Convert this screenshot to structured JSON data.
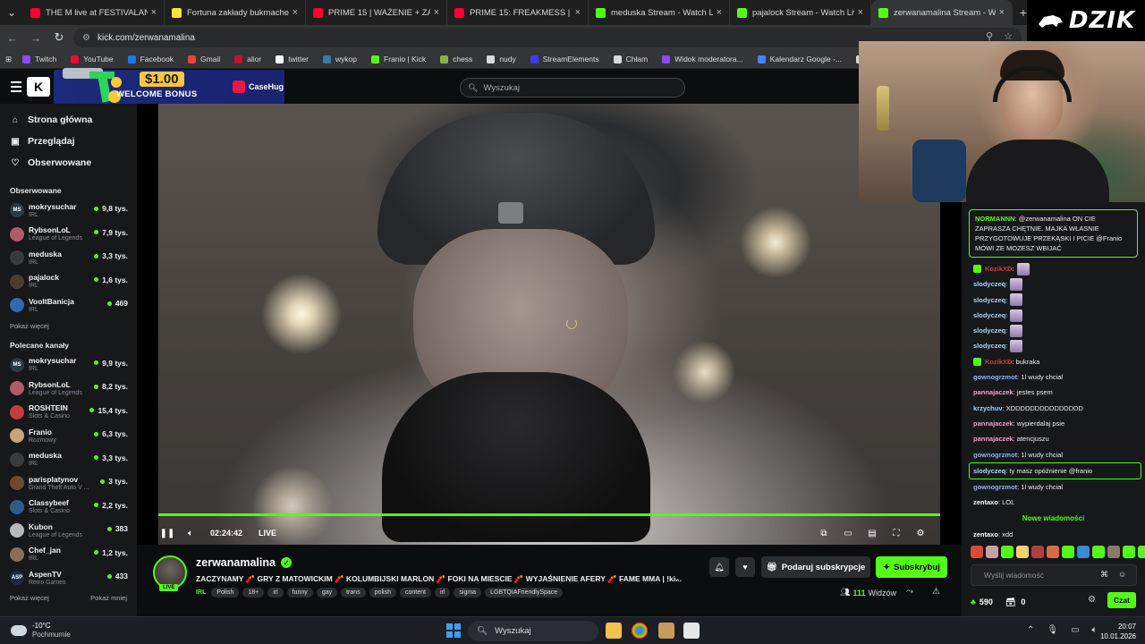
{
  "browser": {
    "tabs": [
      {
        "title": "THE M live at FESTIVALAND 20",
        "favicon_color": "#ff0033"
      },
      {
        "title": "Fortuna zakłady bukmacherskie",
        "favicon_color": "#f6e23b"
      },
      {
        "title": "PRIME 15 | WAŻENIE + ZADYM",
        "favicon_color": "#ff0033"
      },
      {
        "title": "PRIME 15: FREAKMESS | 24H PI",
        "favicon_color": "#ff0033"
      },
      {
        "title": "meduska Stream - Watch Li",
        "favicon_color": "#53fc18"
      },
      {
        "title": "pajalock Stream - Watch Live o",
        "favicon_color": "#53fc18"
      },
      {
        "title": "zerwanamalina Stream - W",
        "favicon_color": "#53fc18",
        "active": true
      }
    ],
    "new_tab": "+",
    "url": "kick.com/zerwanamalina",
    "bookmarks": [
      {
        "label": "Twitch",
        "color": "#9146ff"
      },
      {
        "label": "YouTube",
        "color": "#ff0033"
      },
      {
        "label": "Facebook",
        "color": "#1877f2"
      },
      {
        "label": "Gmail",
        "color": "#ea4335"
      },
      {
        "label": "alior",
        "color": "#c8102e"
      },
      {
        "label": "twitter",
        "color": "#ffffff"
      },
      {
        "label": "wykop",
        "color": "#367aa9"
      },
      {
        "label": "Franio | Kick",
        "color": "#53fc18"
      },
      {
        "label": "chess",
        "color": "#81b64c"
      },
      {
        "label": "nudy",
        "color": "#d8d8d8"
      },
      {
        "label": "StreamElements",
        "color": "#3d3aff"
      },
      {
        "label": "Chłam",
        "color": "#d8d8d8"
      },
      {
        "label": "Widok moderatora...",
        "color": "#9146ff"
      },
      {
        "label": "Kalendarz Google -...",
        "color": "#4285f4"
      },
      {
        "label": "ujeb link",
        "color": "#d8d8d8"
      },
      {
        "label": "be",
        "color": "#e3174a"
      }
    ]
  },
  "overlay": {
    "brand": "DZIK",
    "ad": {
      "amount": "$1.00",
      "text": "WELCOME BONUS",
      "brand": "CaseHug"
    }
  },
  "kick": {
    "logo": "K",
    "search_placeholder": "Wyszukaj",
    "nav": [
      {
        "label": "Strona główna",
        "icon": "home-icon"
      },
      {
        "label": "Przeglądaj",
        "icon": "browse-icon"
      },
      {
        "label": "Obserwowane",
        "icon": "heart-icon"
      }
    ],
    "followed_title": "Obserwowane",
    "followed": [
      {
        "name": "mokrysuchar",
        "category": "IRL",
        "viewers": "9,8 tys.",
        "color": "#2d3a44",
        "initials": "MS"
      },
      {
        "name": "RybsonLoL",
        "category": "League of Legends",
        "viewers": "7,9 tys.",
        "color": "#b05a6a",
        "initials": ""
      },
      {
        "name": "meduska",
        "category": "IRL",
        "viewers": "3,3 tys.",
        "color": "#3a3a3a",
        "initials": ""
      },
      {
        "name": "pajalock",
        "category": "IRL",
        "viewers": "1,6 tys.",
        "color": "#4a3d33",
        "initials": ""
      },
      {
        "name": "VooltBanicja",
        "category": "IRL",
        "viewers": "469",
        "color": "#2d6bb0",
        "initials": ""
      }
    ],
    "show_more": "Pokaż więcej",
    "recommended_title": "Polecane kanały",
    "recommended": [
      {
        "name": "mokrysuchar",
        "category": "IRL",
        "viewers": "9,9 tys.",
        "color": "#2d3a44",
        "initials": "MS"
      },
      {
        "name": "RybsonLoL",
        "category": "League of Legends",
        "viewers": "8,2 tys.",
        "color": "#b05a6a",
        "initials": ""
      },
      {
        "name": "ROSHTEIN",
        "category": "Slots & Casino",
        "viewers": "15,4 tys.",
        "color": "#c23d3d",
        "initials": ""
      },
      {
        "name": "Franio",
        "category": "Rozmowy",
        "viewers": "6,3 tys.",
        "color": "#c9a37a",
        "initials": ""
      },
      {
        "name": "meduska",
        "category": "IRL",
        "viewers": "3,3 tys.",
        "color": "#3a3a3a",
        "initials": ""
      },
      {
        "name": "parisplatynov",
        "category": "Grand Theft Auto V ...",
        "viewers": "3 tys.",
        "color": "#6b4a2e",
        "initials": ""
      },
      {
        "name": "Classybeef",
        "category": "Slots & Casino",
        "viewers": "2,2 tys.",
        "color": "#2e5b8a",
        "initials": ""
      },
      {
        "name": "Kubon",
        "category": "League of Legends",
        "viewers": "383",
        "color": "#b8b8b8",
        "initials": ""
      },
      {
        "name": "Chef_jan",
        "category": "IRL",
        "viewers": "1,2 tys.",
        "color": "#8a6e5a",
        "initials": ""
      },
      {
        "name": "AspenTV",
        "category": "Retro Games",
        "viewers": "433",
        "color": "#1f2a44",
        "initials": "ASP"
      }
    ],
    "show_more_2": "Pokaż więcej",
    "show_less": "Pokaż mniej",
    "player": {
      "time": "02:24:42",
      "live": "LIVE",
      "progress": 1.0
    },
    "stream": {
      "name": "zerwanamalina",
      "live_badge": "LIVE",
      "title": "ZACZYNAMY 🧨 GRY Z MATOWICKIM 🧨 KOLUMBIJSKI MARLON 🧨 FOKI NA MIESCIE 🧨 WYJAŚNIENIE AFERY 🧨 FAME MMA | !ki...",
      "category": "IRL",
      "tags": [
        "Polish",
        "18+",
        "irl",
        "funny",
        "gay",
        "trans",
        "polish",
        "content",
        "irl",
        "sigma",
        "LGBTQIAFriendlySpace"
      ],
      "gift_label": "Podaruj subskrypcje",
      "subscribe_label": "Subskrybuj",
      "viewers_count": "111",
      "viewers_label": "Widzów"
    },
    "chat": {
      "pinned_user": "NORMANNN",
      "pinned_text": ": @zerwanamalina ON CIE ZAPRASZA CHĘTNIE. MAJKA WŁASNIE PRZYGOTOWUJE PRZEKĄSKI I PICIE @Franio MÓWI ZE MOZESZ WBIJAĆ",
      "messages": [
        {
          "user": "KozikXD",
          "text": "",
          "color": "#d63b3b",
          "badge": true,
          "emote": true
        },
        {
          "user": "slodyczeq",
          "text": "",
          "color": "#a4d8ff",
          "emote": true
        },
        {
          "user": "slodyczeq",
          "text": "",
          "color": "#a4d8ff",
          "emote": true
        },
        {
          "user": "slodyczeq",
          "text": "",
          "color": "#a4d8ff",
          "emote": true
        },
        {
          "user": "slodyczeq",
          "text": "",
          "color": "#a4d8ff",
          "emote": true
        },
        {
          "user": "slodyczeq",
          "text": "",
          "color": "#a4d8ff",
          "emote": true
        },
        {
          "user": "KozikXD",
          "text": ": bukraka",
          "color": "#d63b3b",
          "badge": true
        },
        {
          "user": "gownogrzmot",
          "text": ": 1l wudy chcial",
          "color": "#8db4ff"
        },
        {
          "user": "pannajaczek",
          "text": ": jestes psem",
          "color": "#ff9ad1"
        },
        {
          "user": "krzychuv",
          "text": ": XDDDDDDDDDDDDDDD",
          "color": "#a4d8ff"
        },
        {
          "user": "pannajaczek",
          "text": ": wypierdalaj psie",
          "color": "#ff9ad1"
        },
        {
          "user": "pannajaczek",
          "text": ": atencjuszu",
          "color": "#ff9ad1"
        },
        {
          "user": "gownogrzmot",
          "text": ": 1l wudy chcial",
          "color": "#8db4ff"
        },
        {
          "user": "slodyczeq",
          "text": ": ty masz opóźnienie @franio",
          "color": "#a4d8ff",
          "highlight": true
        },
        {
          "user": "gownogrzmot",
          "text": ": 1l wudy chcial",
          "color": "#8db4ff"
        },
        {
          "user": "zentaxo",
          "text": ": LOL",
          "color": "#ffffff"
        }
      ],
      "new_messages": "Nowe wiadomości",
      "last_message": {
        "user": "zentaxo",
        "text": ": xdd",
        "color": "#ffffff"
      },
      "emote_colors": [
        "#d94a3a",
        "#c9a0a0",
        "#53fc18",
        "#f3d36b",
        "#b04040",
        "#d96b4a",
        "#53fc18",
        "#3a8ad6",
        "#53fc18",
        "#8a7a6a",
        "#53fc18",
        "#53fc18"
      ],
      "input_placeholder": "Wyślij wiadomość",
      "points": "590",
      "gifts": "0",
      "send_label": "Czat"
    }
  },
  "taskbar": {
    "temperature": "-10°C",
    "weather": "Pochmurnie",
    "search": "Wyszukaj",
    "time": "20:07",
    "date": "10.01.2026"
  }
}
